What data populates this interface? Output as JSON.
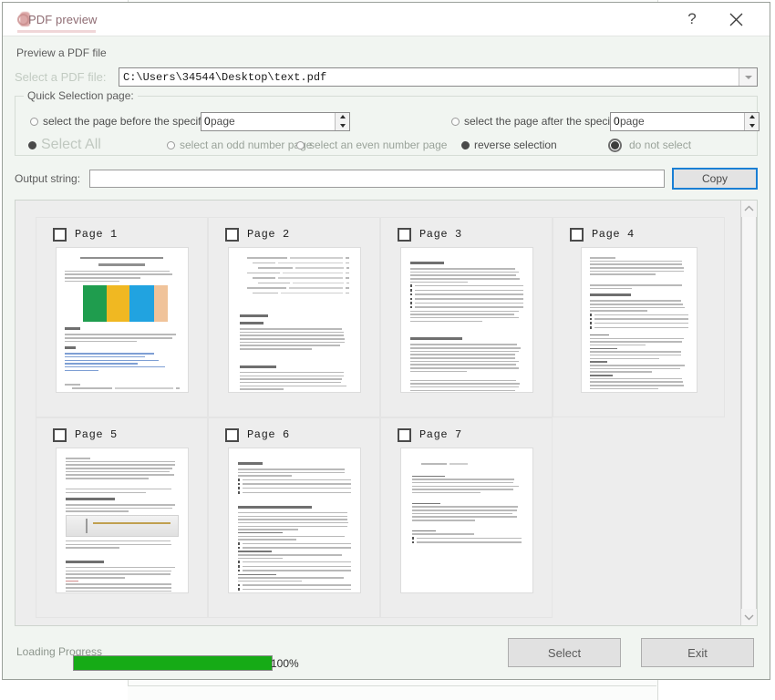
{
  "window": {
    "title": "PDF preview",
    "help_label": "?",
    "close_label": "X"
  },
  "preview": {
    "section_label": "Preview a PDF file",
    "file_label": "Select a PDF file:",
    "file_value": "C:\\Users\\34544\\Desktop\\text.pdf"
  },
  "quick_selection": {
    "title": "Quick Selection page:",
    "option_before": "select the page before the specified",
    "option_before_suffix": "page",
    "spin_before_value": "0",
    "option_after": "select the page after the specified",
    "option_after_suffix": "page",
    "spin_after_value": "0",
    "select_all": "Select All",
    "odd": "select an odd number page",
    "even": "select an even number page",
    "reverse": "reverse selection",
    "do_not_select": "do not select"
  },
  "output": {
    "label": "Output string:",
    "value": "",
    "placeholder": "",
    "copy_label": "Copy"
  },
  "pages": [
    {
      "label": "Page 1",
      "checked": false,
      "style": "cover"
    },
    {
      "label": "Page 2",
      "checked": false,
      "style": "toc"
    },
    {
      "label": "Page 3",
      "checked": false,
      "style": "text"
    },
    {
      "label": "Page 4",
      "checked": false,
      "style": "narrow"
    },
    {
      "label": "Page 5",
      "checked": false,
      "style": "image"
    },
    {
      "label": "Page 6",
      "checked": false,
      "style": "dense"
    },
    {
      "label": "Page 7",
      "checked": false,
      "style": "sparse"
    }
  ],
  "footer": {
    "progress_label": "Loading Progress",
    "progress_percent": "100%",
    "progress_value": 100,
    "select_label": "Select",
    "exit_label": "Exit"
  },
  "colors": {
    "dialog_bg": "#f1f5f1",
    "progress_green": "#16ab16",
    "focus_blue": "#1a7fd4",
    "title_text": "#8e6b72"
  }
}
